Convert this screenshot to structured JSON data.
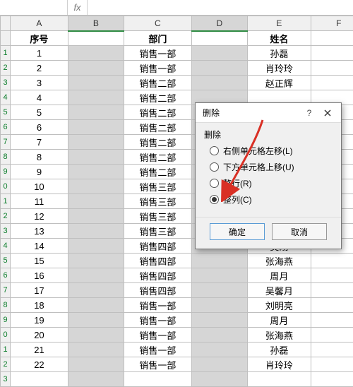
{
  "formula_bar": {
    "fx": "fx"
  },
  "columns": [
    "A",
    "B",
    "C",
    "D",
    "E",
    "F"
  ],
  "selected_columns": [
    "B",
    "D"
  ],
  "header_row": {
    "A": "序号",
    "C": "部门",
    "E": "姓名"
  },
  "rows": [
    {
      "n": "1",
      "seq": "1",
      "dept": "销售一部",
      "name": "孙磊"
    },
    {
      "n": "2",
      "seq": "2",
      "dept": "销售一部",
      "name": "肖玲玲"
    },
    {
      "n": "3",
      "seq": "3",
      "dept": "销售二部",
      "name": "赵正辉"
    },
    {
      "n": "4",
      "seq": "4",
      "dept": "销售二部",
      "name": ""
    },
    {
      "n": "5",
      "seq": "5",
      "dept": "销售二部",
      "name": ""
    },
    {
      "n": "6",
      "seq": "6",
      "dept": "销售二部",
      "name": ""
    },
    {
      "n": "7",
      "seq": "7",
      "dept": "销售二部",
      "name": ""
    },
    {
      "n": "8",
      "seq": "8",
      "dept": "销售二部",
      "name": ""
    },
    {
      "n": "9",
      "seq": "9",
      "dept": "销售二部",
      "name": ""
    },
    {
      "n": "0",
      "seq": "10",
      "dept": "销售三部",
      "name": ""
    },
    {
      "n": "1",
      "seq": "11",
      "dept": "销售三部",
      "name": ""
    },
    {
      "n": "2",
      "seq": "12",
      "dept": "销售三部",
      "name": ""
    },
    {
      "n": "3",
      "seq": "13",
      "dept": "销售三部",
      "name": ""
    },
    {
      "n": "4",
      "seq": "14",
      "dept": "销售四部",
      "name": "吴刚"
    },
    {
      "n": "5",
      "seq": "15",
      "dept": "销售四部",
      "name": "张海燕"
    },
    {
      "n": "6",
      "seq": "16",
      "dept": "销售四部",
      "name": "周月"
    },
    {
      "n": "7",
      "seq": "17",
      "dept": "销售四部",
      "name": "吴馨月"
    },
    {
      "n": "8",
      "seq": "18",
      "dept": "销售一部",
      "name": "刘明亮"
    },
    {
      "n": "9",
      "seq": "19",
      "dept": "销售一部",
      "name": "周月"
    },
    {
      "n": "0",
      "seq": "20",
      "dept": "销售一部",
      "name": "张海燕"
    },
    {
      "n": "1",
      "seq": "21",
      "dept": "销售一部",
      "name": "孙磊"
    },
    {
      "n": "2",
      "seq": "22",
      "dept": "销售一部",
      "name": "肖玲玲"
    },
    {
      "n": "3",
      "seq": "",
      "dept": "",
      "name": ""
    }
  ],
  "dialog": {
    "title": "删除",
    "help_tip": "?",
    "group": "删除",
    "options": {
      "shift_left": "右侧单元格左移(L)",
      "shift_up": "下方单元格上移(U)",
      "entire_row": "整行(R)",
      "entire_col": "整列(C)"
    },
    "selected": "entire_col",
    "ok": "确定",
    "cancel": "取消"
  },
  "watermark": ""
}
